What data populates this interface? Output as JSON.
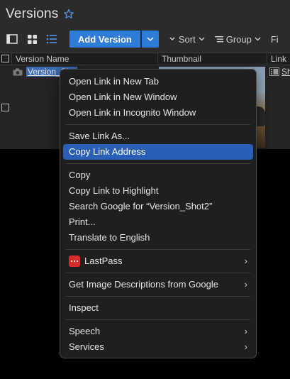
{
  "app": {
    "title": "Versions",
    "toolbar": {
      "add_version_label": "Add Version",
      "sort_label": "Sort",
      "group_label": "Group",
      "cut_label": "Fi"
    },
    "table": {
      "columns": [
        "Version Name",
        "Thumbnail",
        "Link"
      ],
      "row": {
        "name_visible": "Version_Sho",
        "link_visible": "Sh"
      }
    }
  },
  "context_menu": {
    "items": [
      {
        "label": "Open Link in New Tab"
      },
      {
        "label": "Open Link in New Window"
      },
      {
        "label": "Open Link in Incognito Window"
      },
      {
        "label": "Save Link As..."
      },
      {
        "label": "Copy Link Address",
        "highlighted": true
      },
      {
        "label": "Copy"
      },
      {
        "label": "Copy Link to Highlight"
      },
      {
        "label": "Search Google for “Version_Shot2”"
      },
      {
        "label": "Print..."
      },
      {
        "label": "Translate to English"
      },
      {
        "label": "LastPass",
        "submenu": true
      },
      {
        "label": "Get Image Descriptions from Google",
        "submenu": true
      },
      {
        "label": "Inspect"
      },
      {
        "label": "Speech",
        "submenu": true
      },
      {
        "label": "Services",
        "submenu": true
      }
    ],
    "submenu_glyph": "›"
  },
  "colors": {
    "accent": "#2f7bd8",
    "highlight": "#2a5fb8",
    "lastpass": "#d32d27"
  },
  "icons": [
    "star-icon",
    "list-view-icon",
    "grid-view-icon",
    "detail-view-icon",
    "chevron-down-icon",
    "sort-icon",
    "group-icon",
    "camera-icon",
    "film-icon",
    "lastpass-icon"
  ]
}
